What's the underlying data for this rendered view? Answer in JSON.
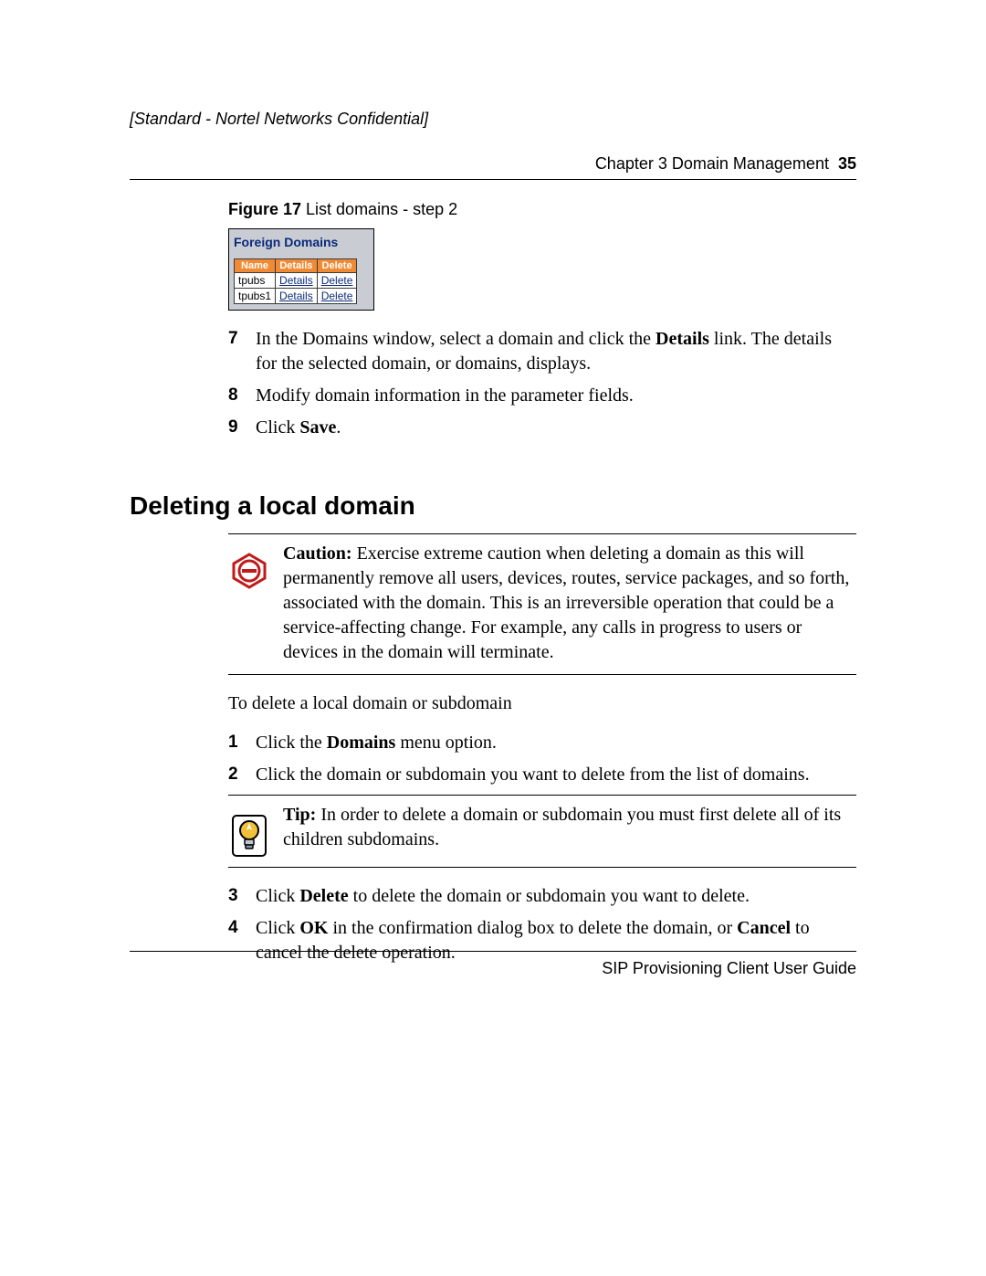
{
  "header": {
    "confidential": "[Standard - Nortel Networks Confidential]",
    "chapter_label": "Chapter 3  Domain Management",
    "page_number": "35"
  },
  "figure": {
    "label_bold": "Figure 17",
    "label_rest": "   List domains - step 2",
    "widget_title": "Foreign Domains",
    "columns": {
      "name": "Name",
      "details": "Details",
      "delete": "Delete"
    },
    "rows": [
      {
        "name": "tpubs",
        "details": "Details",
        "delete": "Delete"
      },
      {
        "name": "tpubs1",
        "details": "Details",
        "delete": "Delete"
      }
    ]
  },
  "steps_a": [
    {
      "n": "7",
      "html": "In the Domains window, select a domain and click the <b>Details</b> link. The details for the selected domain, or domains, displays."
    },
    {
      "n": "8",
      "html": "Modify domain information in the parameter fields."
    },
    {
      "n": "9",
      "html": "Click <b>Save</b>."
    }
  ],
  "section_heading": "Deleting a local domain",
  "caution": {
    "label": "Caution:",
    "text": " Exercise extreme caution when deleting a domain as this will permanently remove all users, devices, routes, service packages, and so forth, associated with the domain. This is an irreversible operation that could be a service-affecting change. For example, any calls in progress to users or devices in the domain will terminate."
  },
  "intro_para": "To delete a local domain or subdomain",
  "steps_b1": [
    {
      "n": "1",
      "html": "Click the <b>Domains</b> menu option."
    },
    {
      "n": "2",
      "html": "Click the domain or subdomain you want to delete from the list of domains."
    }
  ],
  "tip": {
    "label": "Tip:",
    "text": " In order to delete a domain or subdomain you must first delete all of its children subdomains."
  },
  "steps_b2": [
    {
      "n": "3",
      "html": "Click <b>Delete</b> to delete the domain or subdomain you want to delete."
    },
    {
      "n": "4",
      "html": "Click <b>OK</b> in the confirmation dialog box to delete the domain, or <b>Cancel</b> to cancel the delete operation."
    }
  ],
  "footer": {
    "guide": "SIP Provisioning Client User Guide"
  }
}
